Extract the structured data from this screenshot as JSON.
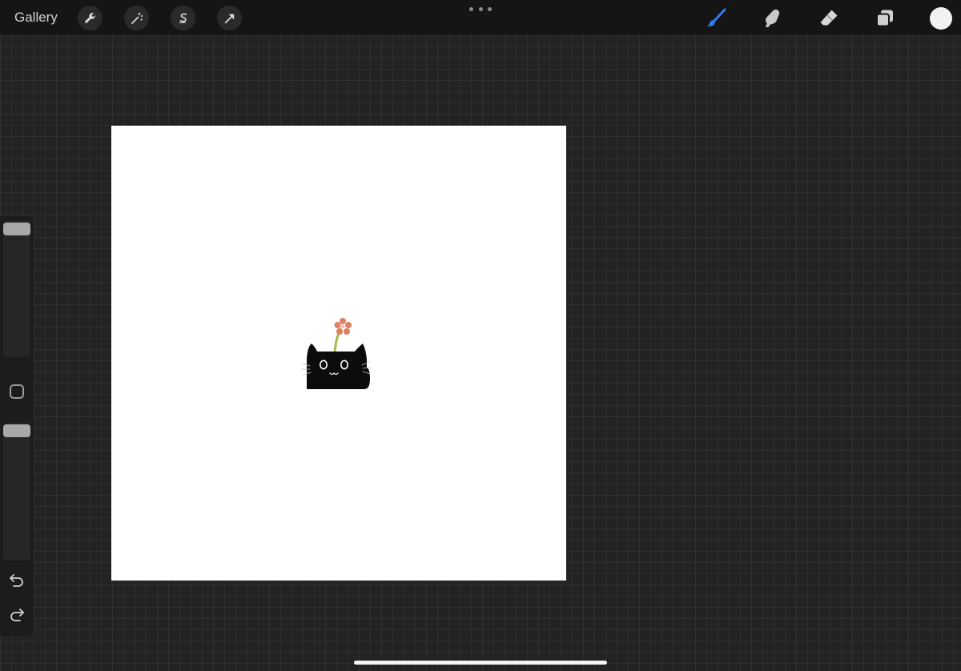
{
  "topbar": {
    "gallery_label": "Gallery",
    "left_tools": [
      {
        "name": "actions",
        "icon": "wrench-icon"
      },
      {
        "name": "adjustments",
        "icon": "magic-wand-icon"
      },
      {
        "name": "selection",
        "icon": "selection-s-icon"
      },
      {
        "name": "transform",
        "icon": "arrow-cursor-icon"
      }
    ],
    "more_menu_icon": "ellipsis-icon",
    "right_tools": [
      {
        "name": "brush",
        "icon": "brush-icon",
        "active": true
      },
      {
        "name": "smudge",
        "icon": "smudge-finger-icon",
        "active": false
      },
      {
        "name": "eraser",
        "icon": "eraser-icon",
        "active": false
      },
      {
        "name": "layers",
        "icon": "layers-icon",
        "active": false
      }
    ],
    "current_color": "#f2f2f2"
  },
  "sidebar": {
    "brush_size_level": 1.0,
    "brush_opacity_level": 1.0,
    "modify_button_icon": "square-outline-icon",
    "undo_icon": "undo-icon",
    "redo_icon": "redo-icon"
  },
  "canvas": {
    "background_color": "#ffffff",
    "artwork": "black-cat-with-flower-drawing"
  },
  "colors": {
    "accent_active": "#2e7bf6",
    "flower": "#e07e62",
    "stem": "#a9b84a",
    "cat": "#0c0c0c"
  }
}
